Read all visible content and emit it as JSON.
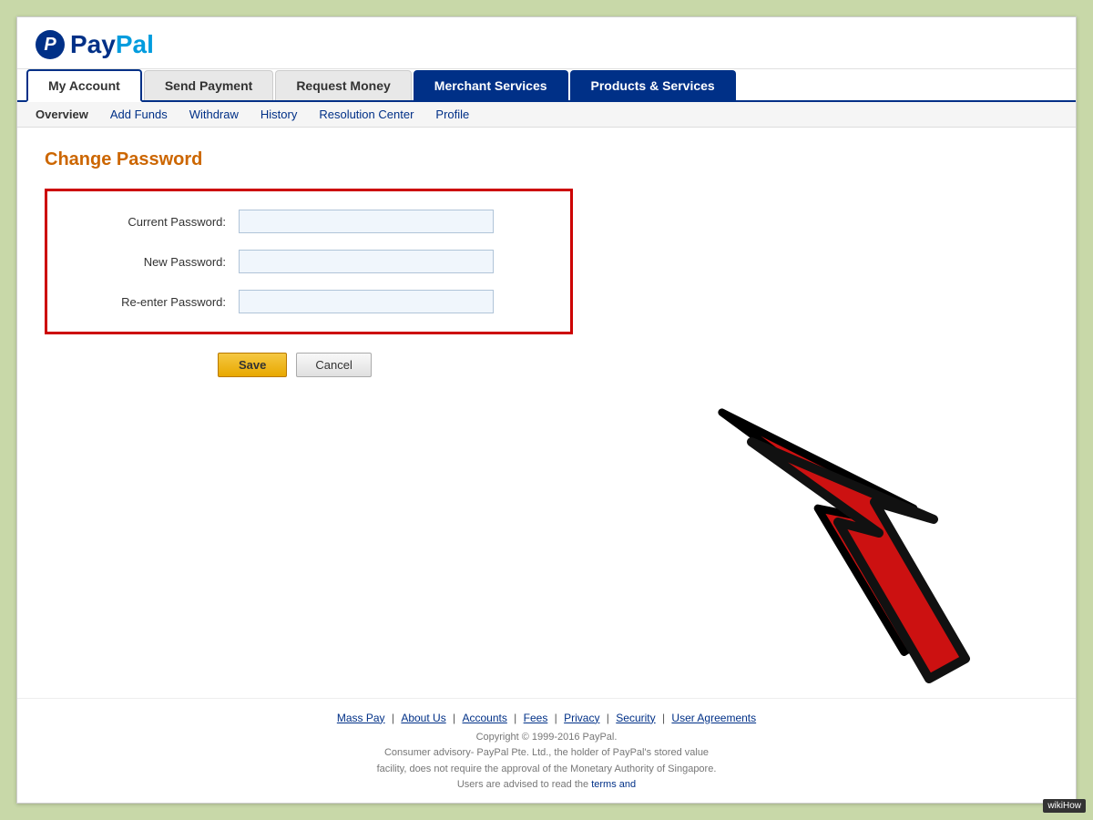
{
  "app": {
    "title": "PayPal",
    "logo_letter": "P",
    "logo_pay": "Pay",
    "logo_pal": "Pal"
  },
  "nav": {
    "tabs": [
      {
        "label": "My Account",
        "active": true,
        "dark": false
      },
      {
        "label": "Send Payment",
        "active": false,
        "dark": false
      },
      {
        "label": "Request Money",
        "active": false,
        "dark": false
      },
      {
        "label": "Merchant Services",
        "active": false,
        "dark": true
      },
      {
        "label": "Products & Services",
        "active": false,
        "dark": true
      }
    ],
    "subnav": [
      {
        "label": "Overview",
        "active": true
      },
      {
        "label": "Add Funds",
        "active": false
      },
      {
        "label": "Withdraw",
        "active": false
      },
      {
        "label": "History",
        "active": false
      },
      {
        "label": "Resolution Center",
        "active": false
      },
      {
        "label": "Profile",
        "active": false
      }
    ]
  },
  "page": {
    "title": "Change Password"
  },
  "form": {
    "current_password_label": "Current Password:",
    "new_password_label": "New Password:",
    "reenter_password_label": "Re-enter Password:",
    "current_password_value": "",
    "new_password_value": "",
    "reenter_password_value": ""
  },
  "buttons": {
    "save": "Save",
    "cancel": "Cancel"
  },
  "footer": {
    "links": [
      {
        "label": "Mass Pay"
      },
      {
        "label": "About Us"
      },
      {
        "label": "Accounts"
      },
      {
        "label": "Fees"
      },
      {
        "label": "Privacy"
      },
      {
        "label": "Security"
      },
      {
        "label": "User Agreements"
      }
    ],
    "copyright": "Copyright © 1999-2016 PayPal.",
    "advisory": "Consumer advisory- PayPal Pte. Ltd., the holder of PayPal's stored value",
    "advisory2": "facility, does not require the approval of the Monetary Authority of Singapore.",
    "advisory3": "Users are advised to read the",
    "terms_text": "terms and",
    "separator": "|"
  },
  "wikihow": {
    "label": "wikiHow"
  }
}
